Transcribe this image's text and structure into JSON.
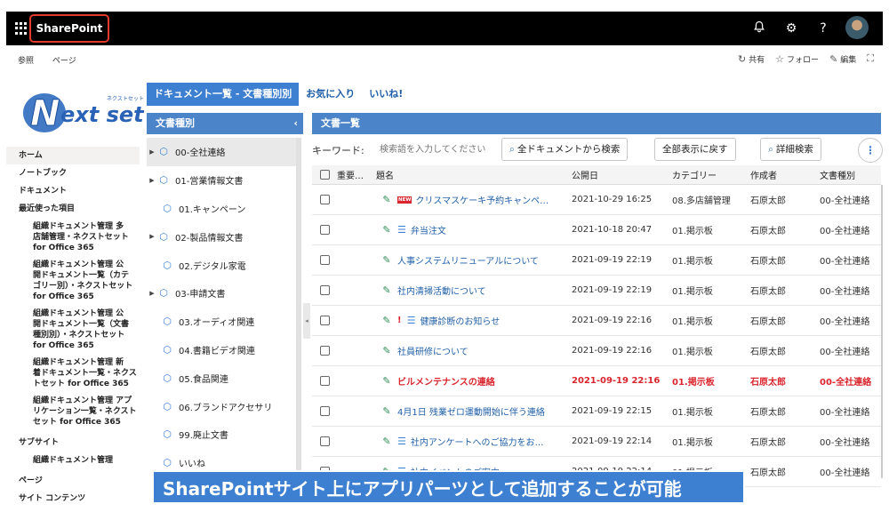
{
  "suitebar": {
    "site_title": "SharePoint"
  },
  "commandbar": {
    "left": [
      "参照",
      "ページ"
    ],
    "share": "共有",
    "follow": "フォロー",
    "edit": "編集"
  },
  "logo": {
    "text": "Next set",
    "kana": "ネクストセット"
  },
  "leftnav": {
    "home": "ホーム",
    "notebook": "ノートブック",
    "documents": "ドキュメント",
    "recent": "最近使った項目",
    "recent_items": [
      "組織ドキュメント管理 多\n店舗管理・ネクストセット\nfor Office 365",
      "組織ドキュメント管理 公\n開ドキュメント一覧（カテ\nゴリー別）・ネクストセット\nfor Office 365",
      "組織ドキュメント管理 公\n開ドキュメント一覧（文書\n種別別）・ネクストセット\nfor Office 365",
      "組織ドキュメント管理 新\n着ドキュメント一覧・ネクス\nトセット for Office 365",
      "組織ドキュメント管理 アプ\nリケーション一覧・ネクスト\nセット for Office 365"
    ],
    "subsites": "サブサイト",
    "subsite_item": "組織ドキュメント管理",
    "pages": "ページ",
    "site_contents": "サイト コンテンツ"
  },
  "tabs": [
    "ドキュメント一覧 - 文書種別別",
    "お気に入り",
    "いいね!"
  ],
  "doctype_panel": {
    "title": "文書種別",
    "collapse": "‹",
    "items": [
      {
        "label": "00-全社連絡",
        "expandable": true,
        "selected": true
      },
      {
        "label": "01-営業情報文書",
        "expandable": true,
        "selected": false
      },
      {
        "label": "01.キャンペーン",
        "expandable": false,
        "selected": false
      },
      {
        "label": "02-製品情報文書",
        "expandable": true,
        "selected": false
      },
      {
        "label": "02.デジタル家電",
        "expandable": false,
        "selected": false
      },
      {
        "label": "03-申請文書",
        "expandable": true,
        "selected": false
      },
      {
        "label": "03.オーディオ関連",
        "expandable": false,
        "selected": false
      },
      {
        "label": "04.書籍ビデオ関連",
        "expandable": false,
        "selected": false
      },
      {
        "label": "05.食品関連",
        "expandable": false,
        "selected": false
      },
      {
        "label": "06.ブランドアクセサリ",
        "expandable": false,
        "selected": false
      },
      {
        "label": "99.廃止文書",
        "expandable": false,
        "selected": false
      },
      {
        "label": "いいね",
        "expandable": false,
        "selected": false
      }
    ]
  },
  "doclist_panel": {
    "title": "文書一覧"
  },
  "search": {
    "label": "キーワード:",
    "placeholder": "検索語を入力してください",
    "search_all": "全ドキュメントから検索",
    "show_all": "全部表示に戻す",
    "advanced": "詳細検索",
    "more": "⋮"
  },
  "grid": {
    "columns": [
      "重要…",
      "題名",
      "公開日",
      "カテゴリー",
      "作成者",
      "文書種別"
    ],
    "rows": [
      {
        "title": "クリスマスケーキ予約キャンペ…",
        "new": true,
        "important": false,
        "list": false,
        "date": "2021-10-29 16:25",
        "category": "08.多店舗管理",
        "author": "石原太郎",
        "type": "00-全社連絡"
      },
      {
        "title": "弁当注文",
        "new": false,
        "important": false,
        "list": true,
        "date": "2021-10-18 20:47",
        "category": "01.掲示板",
        "author": "石原太郎",
        "type": "00-全社連絡"
      },
      {
        "title": "人事システムリニューアルについて",
        "new": false,
        "important": false,
        "list": false,
        "date": "2021-09-19 22:19",
        "category": "01.掲示板",
        "author": "石原太郎",
        "type": "00-全社連絡"
      },
      {
        "title": "社内清掃活動について",
        "new": false,
        "important": false,
        "list": false,
        "date": "2021-09-19 22:19",
        "category": "01.掲示板",
        "author": "石原太郎",
        "type": "00-全社連絡"
      },
      {
        "title": "健康診断のお知らせ",
        "new": false,
        "important": true,
        "list": true,
        "date": "2021-09-19 22:16",
        "category": "01.掲示板",
        "author": "石原太郎",
        "type": "00-全社連絡"
      },
      {
        "title": "社員研修について",
        "new": false,
        "important": false,
        "list": false,
        "date": "2021-09-19 22:16",
        "category": "01.掲示板",
        "author": "石原太郎",
        "type": "00-全社連絡"
      },
      {
        "title": "ビルメンテナンスの連絡",
        "new": false,
        "important": false,
        "list": false,
        "highlight": true,
        "date": "2021-09-19 22:16",
        "category": "01.掲示板",
        "author": "石原太郎",
        "type": "00-全社連絡"
      },
      {
        "title": "4月1日 残業ゼロ運動開始に伴う連絡",
        "new": false,
        "important": false,
        "list": false,
        "date": "2021-09-19 22:15",
        "category": "01.掲示板",
        "author": "石原太郎",
        "type": "00-全社連絡"
      },
      {
        "title": "社内アンケートへのご協力をお…",
        "new": false,
        "important": false,
        "list": true,
        "date": "2021-09-19 22:14",
        "category": "01.掲示板",
        "author": "石原太郎",
        "type": "00-全社連絡"
      },
      {
        "title": "社内イベントのご案内",
        "new": false,
        "important": false,
        "list": true,
        "date": "2021-09-19 22:14",
        "category": "01.掲示板",
        "author": "石原太郎",
        "type": "00-全社連絡"
      }
    ]
  },
  "caption": "SharePointサイト上にアプリパーツとして追加することが可能",
  "colors": {
    "accent": "#3d7fd0",
    "header_blue": "#4b84c9",
    "alert_red": "#d9262e",
    "frame_highlight": "#e23b2e"
  }
}
